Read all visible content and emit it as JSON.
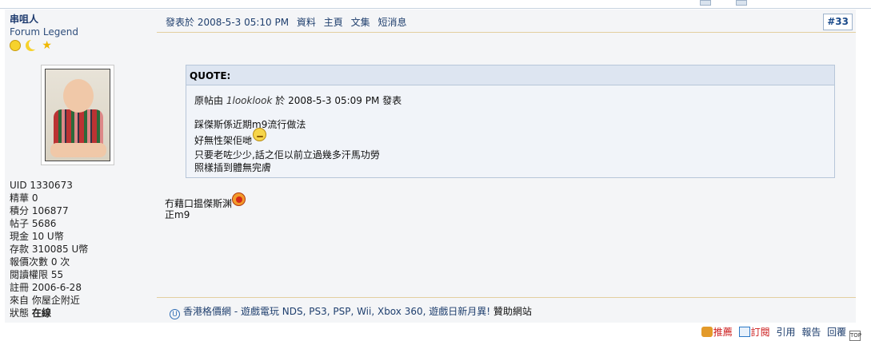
{
  "author": {
    "name": "串咀人",
    "rank": "Forum Legend",
    "rank_icons": [
      "smiley-icon",
      "moon-icon",
      "star-icon"
    ],
    "stats": [
      {
        "label": "UID",
        "value": "1330673"
      },
      {
        "label": "精華",
        "value": "0"
      },
      {
        "label": "積分",
        "value": "106877"
      },
      {
        "label": "帖子",
        "value": "5686"
      },
      {
        "label": "現金",
        "value": "10 U幣"
      },
      {
        "label": "存款",
        "value": "310085 U幣"
      },
      {
        "label": "報價次數",
        "value": "0 次"
      },
      {
        "label": "閱讀權限",
        "value": "55"
      },
      {
        "label": "註冊",
        "value": "2006-6-28"
      },
      {
        "label": "來自",
        "value": "你屋企附近"
      },
      {
        "label": "狀態",
        "value": "在線"
      }
    ]
  },
  "post": {
    "posted_at": "發表於 2008-5-3 05:10 PM",
    "links": [
      "資料",
      "主頁",
      "文集",
      "短消息"
    ],
    "number": "#33",
    "quote": {
      "header": "QUOTE:",
      "origin_prefix": "原帖由",
      "origin_user": "1looklook",
      "origin_suffix": "於 2008-5-3 05:09 PM 發表",
      "lines": [
        "踩傑斯係近期m9流行做法",
        "好無性架佢哋",
        "只要老咗少少,話之佢以前立過幾多汗馬功勞",
        "照樣插到體無完膚"
      ]
    },
    "reply_lines": [
      "冇藉口揾傑斯渊",
      "正m9"
    ]
  },
  "signature": {
    "link_text": "香港格價網 - 遊戲電玩 NDS, PS3, PSP, Wii, Xbox 360, 遊戲日新月異!",
    "plain_text": "贊助網站"
  },
  "actions": {
    "recommend": "推薦",
    "subscribe": "訂閱",
    "cite": "引用",
    "report": "報告",
    "reply": "回覆",
    "top_icon": "TOP"
  },
  "colors": {
    "link": "#1f3f6e",
    "panel_bg": "#f4f5f7",
    "quote_bg": "#f1f4f9",
    "quote_head_bg": "#dde5f1",
    "header_border": "#e3cfa0",
    "action_red": "#cc1d1d"
  }
}
